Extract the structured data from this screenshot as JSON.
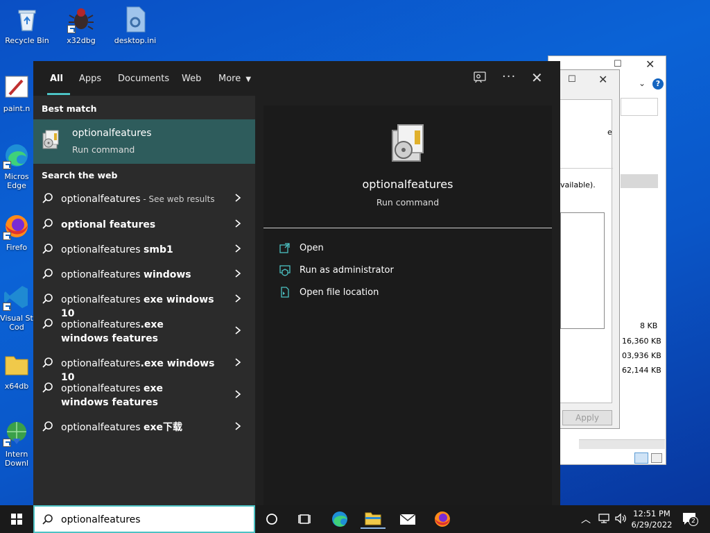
{
  "desktop": {
    "icons": [
      {
        "label": "Recycle Bin"
      },
      {
        "label": "x32dbg"
      },
      {
        "label": "desktop.ini"
      },
      {
        "label": "paint.n"
      },
      {
        "label": "Micros Edge"
      },
      {
        "label": "Firefo"
      },
      {
        "label": "Visual St Cod"
      },
      {
        "label": "x64db"
      },
      {
        "label": "Intern Downl"
      }
    ]
  },
  "background_window": {
    "text_available": "vailable).",
    "text_e": "e",
    "sizes": [
      "8 KB",
      "16,360 KB",
      "03,936 KB",
      "62,144 KB"
    ],
    "apply_label": "Apply"
  },
  "search_panel": {
    "tabs": [
      {
        "label": "All"
      },
      {
        "label": "Apps"
      },
      {
        "label": "Documents"
      },
      {
        "label": "Web"
      },
      {
        "label": "More"
      }
    ],
    "best_match_title": "Best match",
    "best_match": {
      "name": "optionalfeatures",
      "type": "Run command"
    },
    "search_web_title": "Search the web",
    "web_results": [
      {
        "prefix": "optionalfeatures",
        "bold": "",
        "hint": " - See web results"
      },
      {
        "prefix": "",
        "bold": "optional features",
        "hint": ""
      },
      {
        "prefix": "optionalfeatures ",
        "bold": "smb1",
        "hint": ""
      },
      {
        "prefix": "optionalfeatures ",
        "bold": "windows",
        "hint": ""
      },
      {
        "prefix": "optionalfeatures ",
        "bold": "exe windows 10",
        "hint": ""
      },
      {
        "prefix": "optionalfeatures",
        "bold": ".exe windows features",
        "hint": ""
      },
      {
        "prefix": "optionalfeatures",
        "bold": ".exe windows 10",
        "hint": ""
      },
      {
        "prefix": "optionalfeatures ",
        "bold": "exe windows features",
        "hint": ""
      },
      {
        "prefix": "optionalfeatures ",
        "bold": "exe下载",
        "hint": ""
      }
    ],
    "detail": {
      "name": "optionalfeatures",
      "type": "Run command",
      "actions": [
        {
          "label": "Open"
        },
        {
          "label": "Run as administrator"
        },
        {
          "label": "Open file location"
        }
      ]
    }
  },
  "taskbar": {
    "search_value": "optionalfeatures",
    "clock_time": "12:51 PM",
    "clock_date": "6/29/2022",
    "notification_count": "2"
  },
  "colors": {
    "accent": "#4cc2c4",
    "best_match_bg": "#2e5c5c",
    "panel_bg": "#1f1f1f"
  }
}
